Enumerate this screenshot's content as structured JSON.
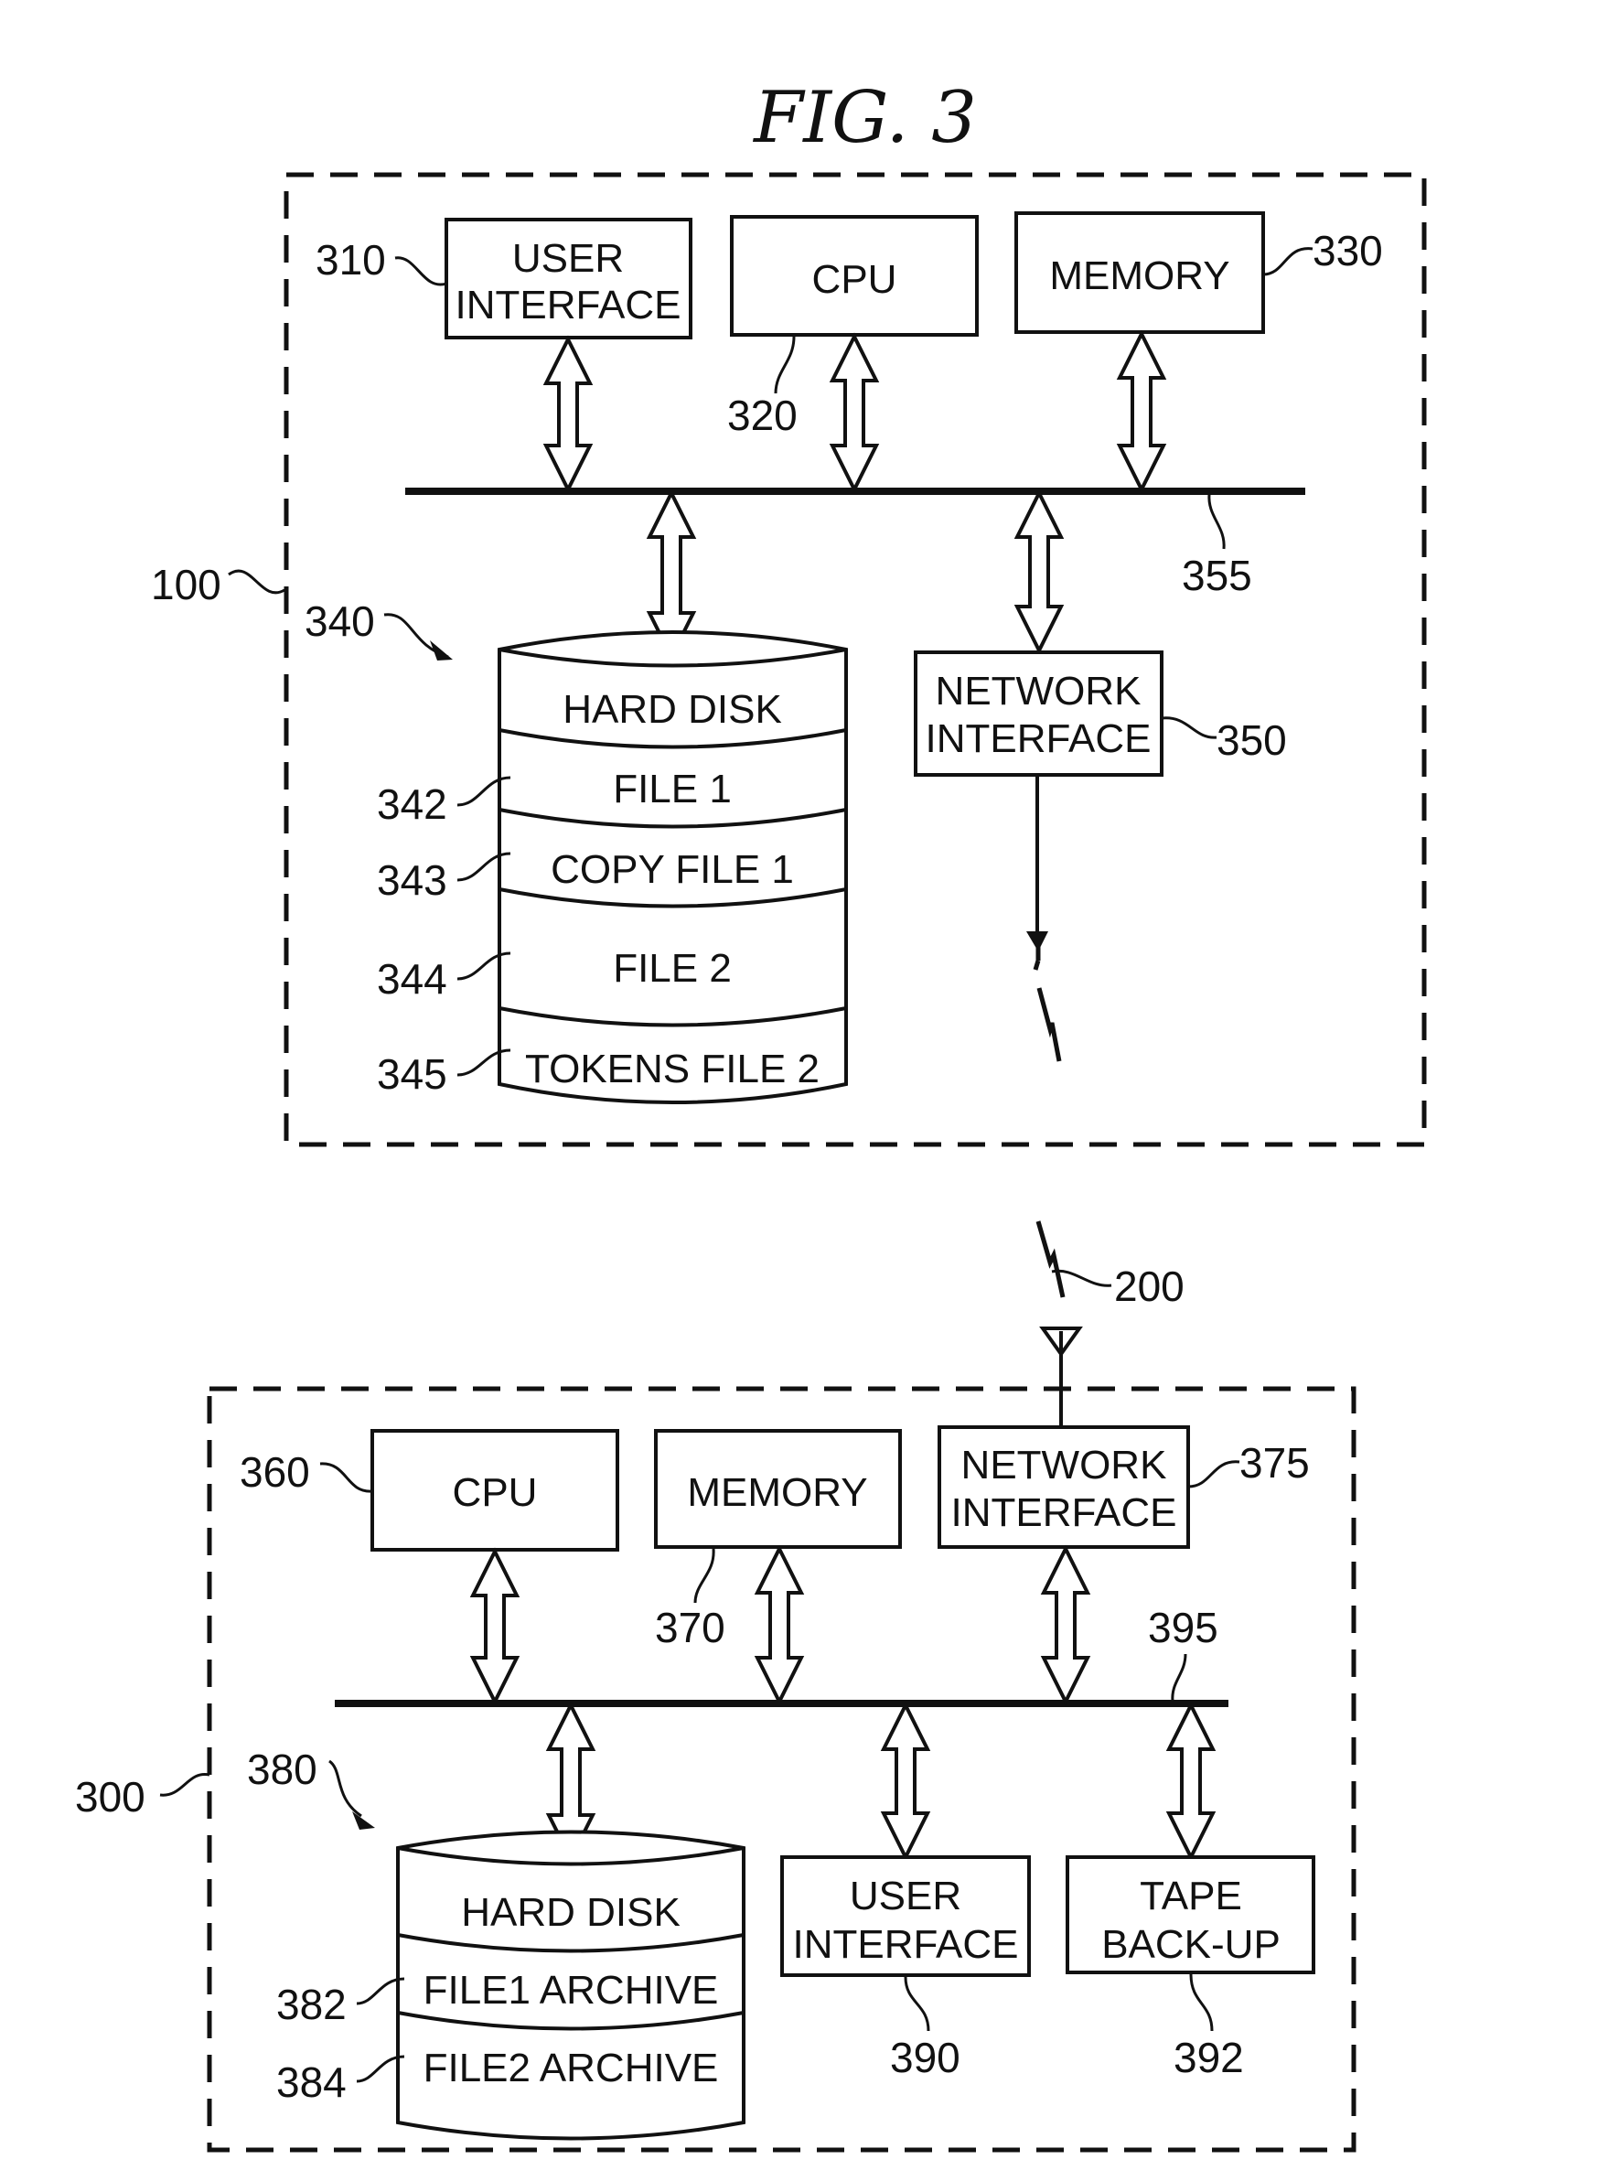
{
  "figure": {
    "title": "FIG.  3",
    "computer_100": {
      "ref": "100",
      "user_interface": {
        "ref": "310",
        "lines": [
          "USER",
          "INTERFACE"
        ]
      },
      "cpu": {
        "ref": "320",
        "lines": [
          "CPU"
        ]
      },
      "memory": {
        "ref": "330",
        "lines": [
          "MEMORY"
        ]
      },
      "bus": {
        "ref": "355"
      },
      "hard_disk": {
        "ref": "340",
        "header": "HARD DISK",
        "sections": [
          {
            "ref": "342",
            "label": "FILE 1"
          },
          {
            "ref": "343",
            "label": "COPY FILE 1"
          },
          {
            "ref": "344",
            "label": "FILE 2"
          },
          {
            "ref": "345",
            "label": "TOKENS FILE 2"
          }
        ]
      },
      "network_interface": {
        "ref": "350",
        "lines": [
          "NETWORK",
          "INTERFACE"
        ]
      }
    },
    "link": {
      "ref": "200"
    },
    "computer_300": {
      "ref": "300",
      "cpu": {
        "ref": "360",
        "lines": [
          "CPU"
        ]
      },
      "memory": {
        "ref": "370",
        "lines": [
          "MEMORY"
        ]
      },
      "network_interface": {
        "ref": "375",
        "lines": [
          "NETWORK",
          "INTERFACE"
        ]
      },
      "bus": {
        "ref": "395"
      },
      "hard_disk": {
        "ref": "380",
        "header": "HARD DISK",
        "sections": [
          {
            "ref": "382",
            "label": "FILE1 ARCHIVE"
          },
          {
            "ref": "384",
            "label": "FILE2 ARCHIVE"
          }
        ]
      },
      "user_interface": {
        "ref": "390",
        "lines": [
          "USER",
          "INTERFACE"
        ]
      },
      "tape_backup": {
        "ref": "392",
        "lines": [
          "TAPE",
          "BACK-UP"
        ]
      }
    }
  }
}
